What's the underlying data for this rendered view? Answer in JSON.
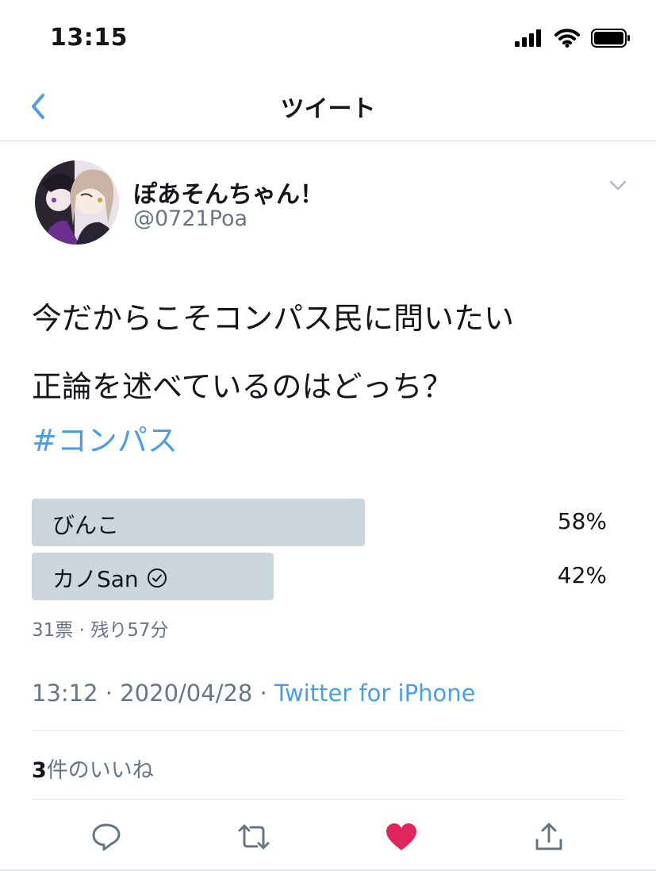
{
  "status_bar": {
    "time": "13:15"
  },
  "nav": {
    "title": "ツイート"
  },
  "tweet": {
    "display_name": "ぽあそんちゃん！",
    "handle": "@0721Poa",
    "text_line1": "今だからこそコンパス民に問いたい",
    "text_line2": "正論を述べているのはどっち？",
    "hashtag": "#コンパス",
    "poll": {
      "options": [
        {
          "label": "びんこ",
          "percent_text": "58%",
          "fraction": 0.58
        },
        {
          "label": "カノSan",
          "percent_text": "42%",
          "fraction": 0.42,
          "has_check_icon": true
        }
      ],
      "meta": "31票 · 残り57分"
    },
    "timestamp": "13:12 · 2020/04/28 · ",
    "source": "Twitter for iPhone",
    "likes_count": "3",
    "likes_label": "件のいいね"
  },
  "actions": [
    "reply-icon",
    "retweet-icon",
    "like-icon",
    "share-icon"
  ],
  "colors": {
    "accent": "#4a9ee8",
    "like": "#e0245e",
    "poll_bar": "#ccd6dd",
    "muted": "#657786"
  }
}
